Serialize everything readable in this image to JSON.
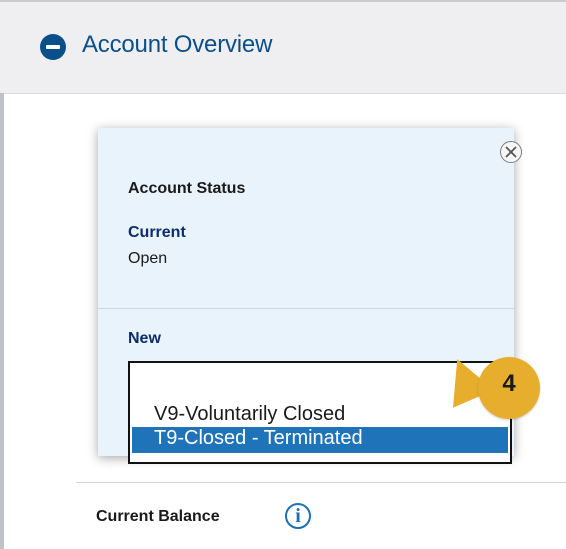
{
  "header": {
    "title": "Account Overview"
  },
  "popup": {
    "section_title": "Account Status",
    "current_label": "Current",
    "current_value": "Open",
    "new_label": "New",
    "options": [
      {
        "label": "V9-Voluntarily Closed",
        "selected": false
      },
      {
        "label": "T9-Closed - Terminated",
        "selected": true
      }
    ]
  },
  "callout": {
    "number": "4",
    "color": "#e7ae2e"
  },
  "balance": {
    "label": "Current Balance",
    "info_icon": "info-icon"
  },
  "colors": {
    "brand": "#0b4f8a",
    "selection": "#1e73b9",
    "popup_bg": "#e9f3fb"
  }
}
